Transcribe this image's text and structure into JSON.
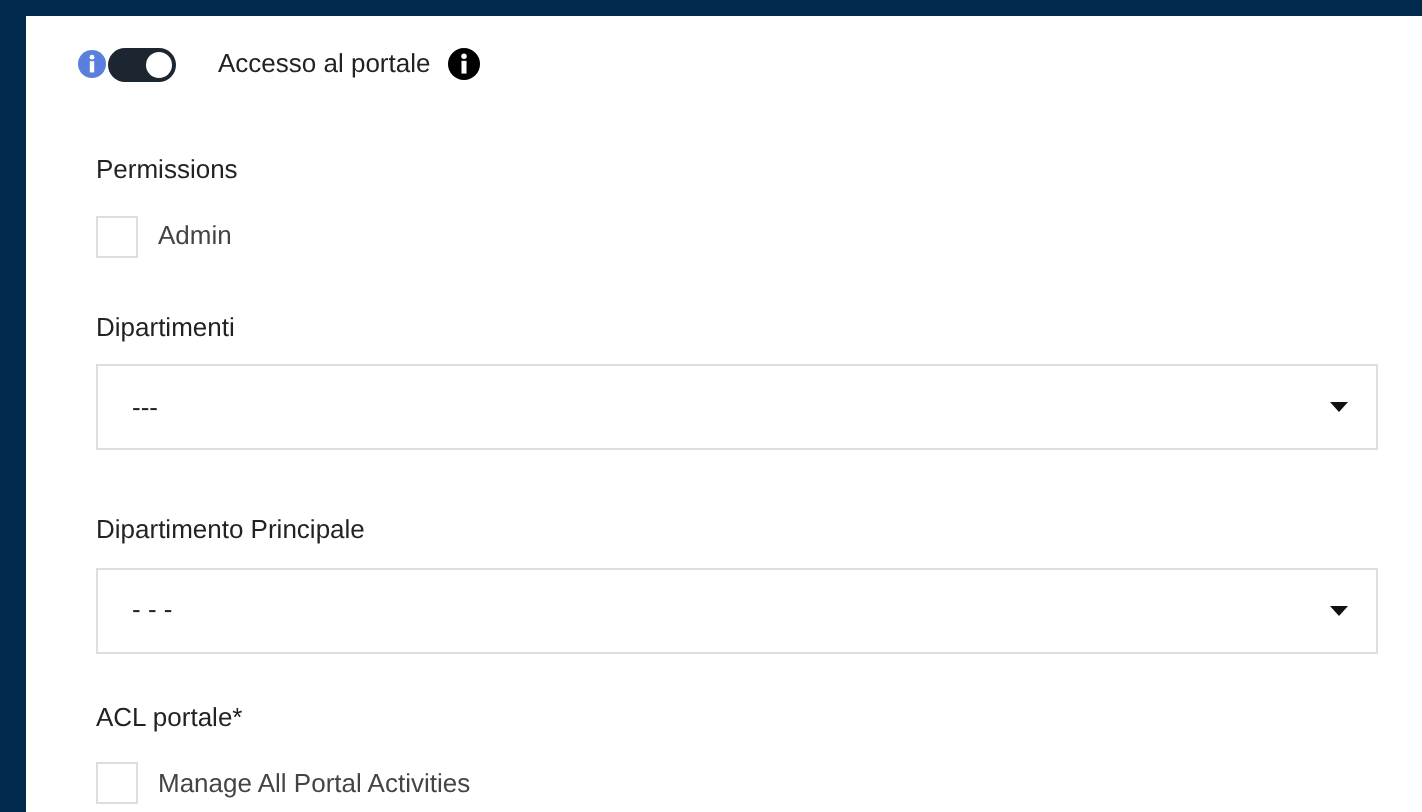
{
  "portal_access": {
    "label": "Accesso al portale",
    "on": true
  },
  "permissions": {
    "label": "Permissions",
    "options": [
      {
        "label": "Admin",
        "checked": false
      }
    ]
  },
  "selects": [
    {
      "label": "Dipartimenti",
      "value": "---"
    },
    {
      "label": "Dipartimento Principale",
      "value": "- - -"
    }
  ],
  "acl": {
    "label": "ACL portale*",
    "options": [
      {
        "label": "Manage All Portal Activities",
        "checked": false
      }
    ]
  }
}
